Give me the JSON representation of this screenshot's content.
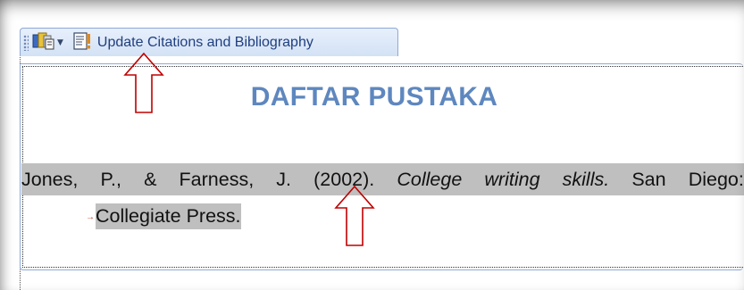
{
  "toolbar": {
    "manage_sources_icon": "bibliography-sources-icon",
    "update_icon": "update-document-icon",
    "update_label": "Update Citations and Bibliography"
  },
  "document": {
    "heading": "DAFTAR PUSTAKA",
    "entry": {
      "line1_words": [
        "Jones,",
        "P.,",
        "&",
        "Farness,",
        "J.",
        "(2002).",
        "College",
        "writing",
        "skills.",
        "San",
        "Diego:"
      ],
      "line1_italic_indexes": [
        6,
        7,
        8
      ],
      "line2": "Collegiate Press."
    }
  },
  "annotations": {
    "arrow_color": "#c00000",
    "arrows": [
      "arrow-up-toolbar",
      "arrow-up-entry"
    ]
  },
  "colors": {
    "heading": "#5e87bf",
    "toolbar_text": "#1f3f7f",
    "highlight": "#bfbfbf"
  }
}
